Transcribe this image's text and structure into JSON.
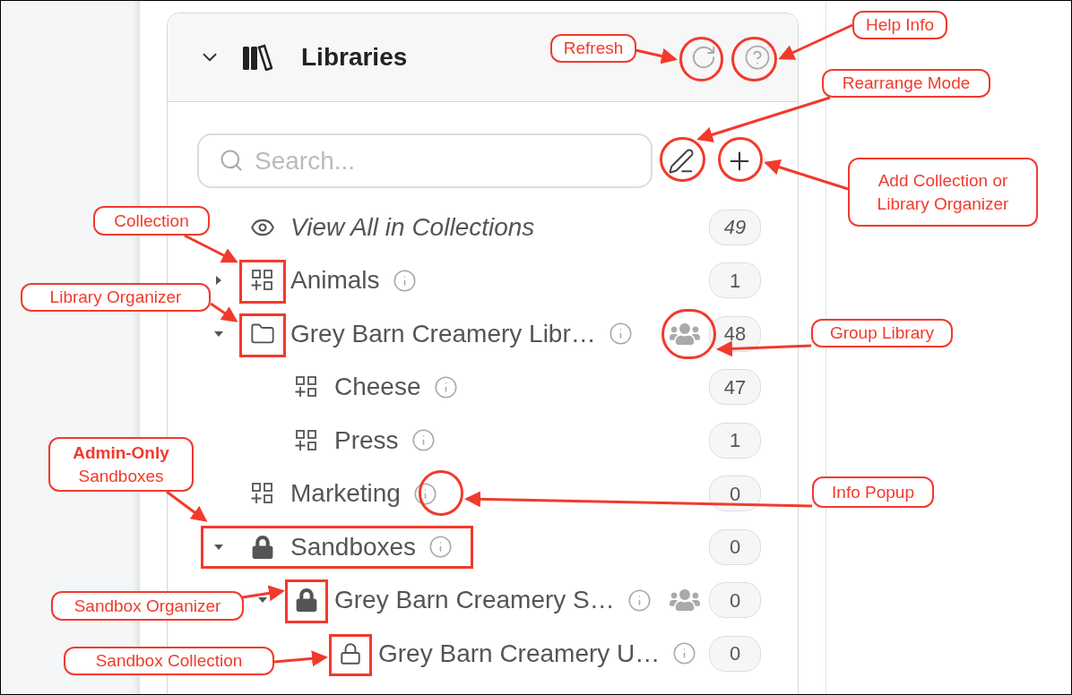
{
  "panel": {
    "title": "Libraries",
    "expanded": true
  },
  "search": {
    "placeholder": "Search..."
  },
  "rows": [
    {
      "kind": "view_all",
      "label": "View All in Collections",
      "count": "49"
    },
    {
      "kind": "collection",
      "label": "Animals",
      "count": "1",
      "expanded": false,
      "info": true,
      "group": false,
      "children": []
    },
    {
      "kind": "organizer",
      "label": "Grey Barn Creamery Libr…",
      "count": "48",
      "expanded": true,
      "info": true,
      "group": true,
      "children": [
        {
          "kind": "collection",
          "label": "Cheese",
          "count": "47",
          "info": true,
          "group": false
        },
        {
          "kind": "collection",
          "label": "Press",
          "count": "1",
          "info": true,
          "group": false
        }
      ]
    },
    {
      "kind": "collection",
      "label": "Marketing",
      "count": "0",
      "info": true,
      "group": false
    },
    {
      "kind": "sandboxes",
      "label": "Sandboxes",
      "count": "0",
      "expanded": true,
      "info": true,
      "group": false,
      "children": [
        {
          "kind": "sandbox_organizer",
          "label": "Grey Barn Creamery S…",
          "count": "0",
          "expanded": true,
          "info": true,
          "group": true,
          "children": [
            {
              "kind": "sandbox_collection",
              "label": "Grey Barn Creamery U…",
              "count": "0",
              "info": true,
              "group": false
            }
          ]
        }
      ]
    }
  ],
  "annotations": [
    {
      "text": "Refresh"
    },
    {
      "text": "Help Info"
    },
    {
      "text": "Rearrange Mode"
    },
    {
      "text": "Add Collection or Library Organizer"
    },
    {
      "text": "Collection"
    },
    {
      "text": "Library Organizer"
    },
    {
      "text": "Group Library"
    },
    {
      "text": "**Admin-Only** Sandboxes"
    },
    {
      "text": "Info Popup"
    },
    {
      "text": "Sandbox Organizer"
    },
    {
      "text": "Sandbox Collection"
    }
  ]
}
